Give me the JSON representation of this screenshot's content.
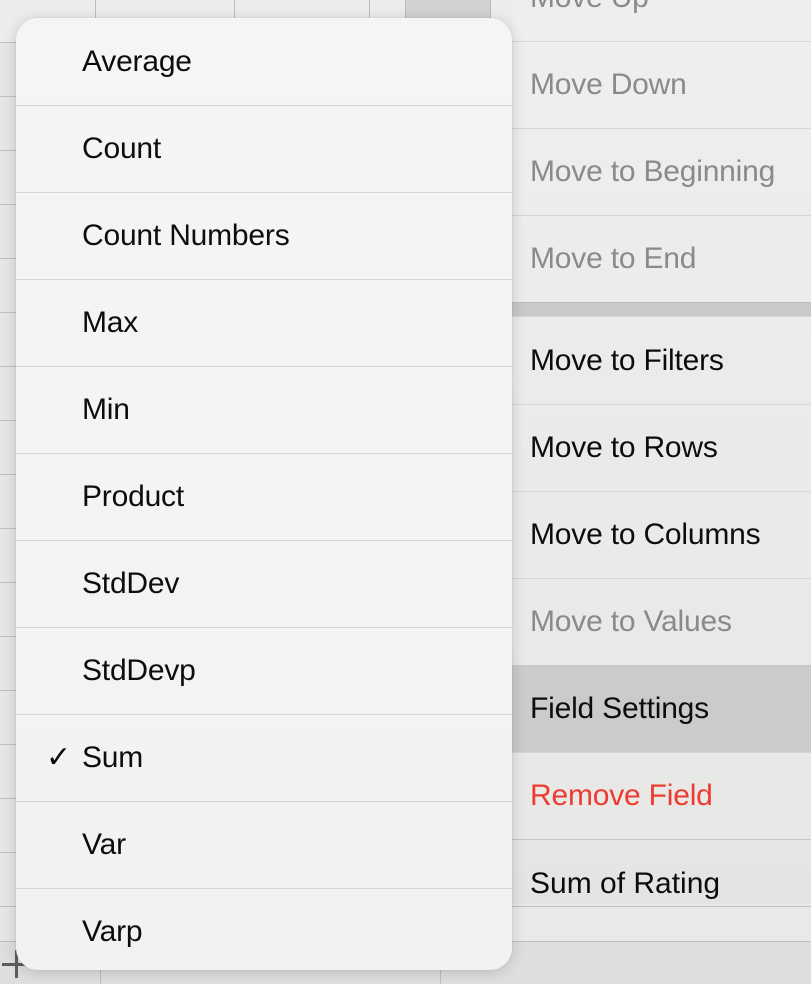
{
  "spreadsheet": {
    "add_sheet_icon": "plus-icon",
    "column_headers": [
      {
        "selected": false
      },
      {
        "selected": false
      },
      {
        "selected": false
      },
      {
        "selected": false
      },
      {
        "selected": true
      }
    ]
  },
  "aggregate_popup": {
    "name": "summarize-values-by-menu",
    "checkmark_glyph": "✓",
    "items": [
      {
        "label": "Average",
        "checked": false
      },
      {
        "label": "Count",
        "checked": false
      },
      {
        "label": "Count Numbers",
        "checked": false
      },
      {
        "label": "Max",
        "checked": false
      },
      {
        "label": "Min",
        "checked": false
      },
      {
        "label": "Product",
        "checked": false
      },
      {
        "label": "StdDev",
        "checked": false
      },
      {
        "label": "StdDevp",
        "checked": false
      },
      {
        "label": "Sum",
        "checked": true
      },
      {
        "label": "Var",
        "checked": false
      },
      {
        "label": "Varp",
        "checked": false
      }
    ]
  },
  "context_menu": {
    "name": "pivot-field-context-menu",
    "groups": [
      {
        "items": [
          {
            "label": "Move Up",
            "state": "disabled"
          },
          {
            "label": "Move Down",
            "state": "disabled"
          },
          {
            "label": "Move to Beginning",
            "state": "disabled"
          },
          {
            "label": "Move to End",
            "state": "disabled"
          }
        ]
      },
      {
        "items": [
          {
            "label": "Move to Filters",
            "state": "enabled"
          },
          {
            "label": "Move to Rows",
            "state": "enabled"
          },
          {
            "label": "Move to Columns",
            "state": "enabled"
          },
          {
            "label": "Move to Values",
            "state": "disabled"
          },
          {
            "label": "Field Settings",
            "state": "highlighted"
          },
          {
            "label": "Remove Field",
            "state": "destructive"
          }
        ]
      }
    ],
    "footer": {
      "label": "Sum of Rating",
      "visible_text": "m of Rating"
    }
  }
}
